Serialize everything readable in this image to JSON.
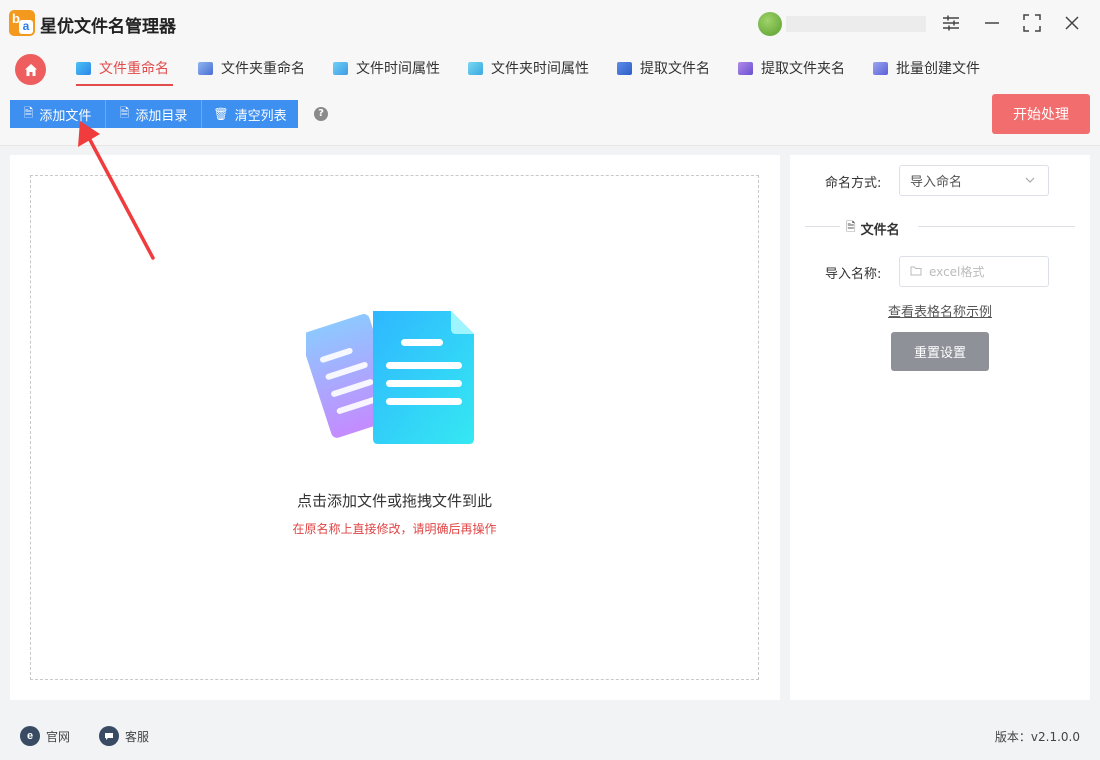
{
  "app": {
    "title": "星优文件名管理器"
  },
  "tabs": [
    {
      "label": "文件重命名",
      "active": true
    },
    {
      "label": "文件夹重命名",
      "active": false
    },
    {
      "label": "文件时间属性",
      "active": false
    },
    {
      "label": "文件夹时间属性",
      "active": false
    },
    {
      "label": "提取文件名",
      "active": false
    },
    {
      "label": "提取文件夹名",
      "active": false
    },
    {
      "label": "批量创建文件",
      "active": false
    }
  ],
  "toolbar": {
    "add_file": "添加文件",
    "add_dir": "添加目录",
    "clear_list": "清空列表",
    "help": "?",
    "start": "开始处理"
  },
  "dropzone": {
    "hint": "点击添加文件或拖拽文件到此",
    "warning": "在原名称上直接修改，请明确后再操作"
  },
  "settings": {
    "naming_label": "命名方式:",
    "naming_value": "导入命名",
    "section_title": "文件名",
    "import_label": "导入名称:",
    "import_placeholder": "excel格式",
    "example_link": "查看表格名称示例",
    "reset": "重置设置"
  },
  "footer": {
    "website": "官网",
    "support": "客服",
    "version": "版本：v2.1.0.0"
  },
  "colors": {
    "accent_red": "#e24b4b",
    "primary_blue": "#3d8ff0",
    "start_button": "#f26d6d"
  }
}
